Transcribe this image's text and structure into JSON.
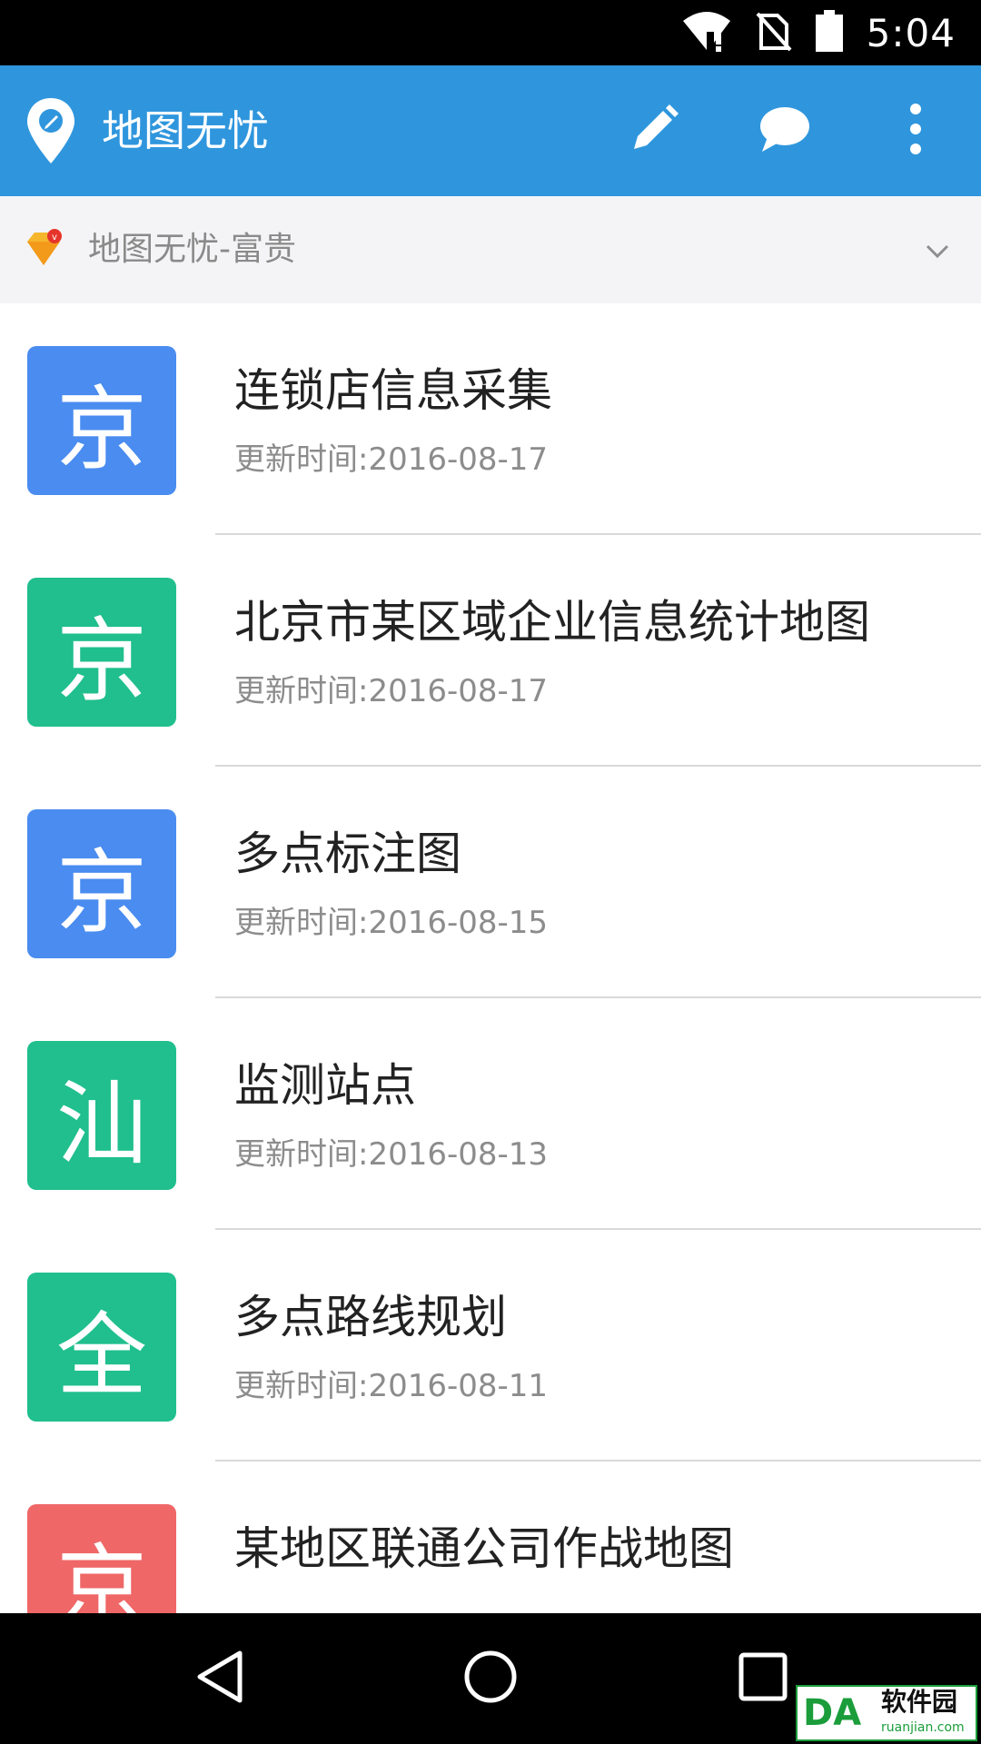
{
  "status_bar": {
    "time": "5:04",
    "icons": [
      "wifi-alert-icon",
      "no-sim-icon",
      "battery-icon"
    ]
  },
  "app_bar": {
    "title": "地图无忧",
    "logo": "map-pin-pencil-icon",
    "actions": [
      "edit-icon",
      "chat-icon",
      "more-vert-icon"
    ],
    "color": "#2f96dd"
  },
  "account": {
    "name": "地图无忧-富贵",
    "badge": "vip-diamond-icon"
  },
  "items": [
    {
      "avatar": "京",
      "color": "#4a8cf0",
      "title": "连锁店信息采集",
      "subtitle": "更新时间:2016-08-17"
    },
    {
      "avatar": "京",
      "color": "#20bf8d",
      "title": "北京市某区域企业信息统计地图",
      "subtitle": "更新时间:2016-08-17"
    },
    {
      "avatar": "京",
      "color": "#4a8cf0",
      "title": "多点标注图",
      "subtitle": "更新时间:2016-08-15"
    },
    {
      "avatar": "汕",
      "color": "#20bf8d",
      "title": "监测站点",
      "subtitle": "更新时间:2016-08-13"
    },
    {
      "avatar": "全",
      "color": "#20bf8d",
      "title": "多点路线规划",
      "subtitle": "更新时间:2016-08-11"
    },
    {
      "avatar": "京",
      "color": "#ef6767",
      "title": "某地区联通公司作战地图",
      "subtitle": ""
    }
  ],
  "nav_bar": {
    "buttons": [
      "back-icon",
      "home-icon",
      "recents-icon"
    ]
  },
  "watermark": {
    "logo": "DA",
    "text": "软件园",
    "url": "ruanjian.com"
  }
}
